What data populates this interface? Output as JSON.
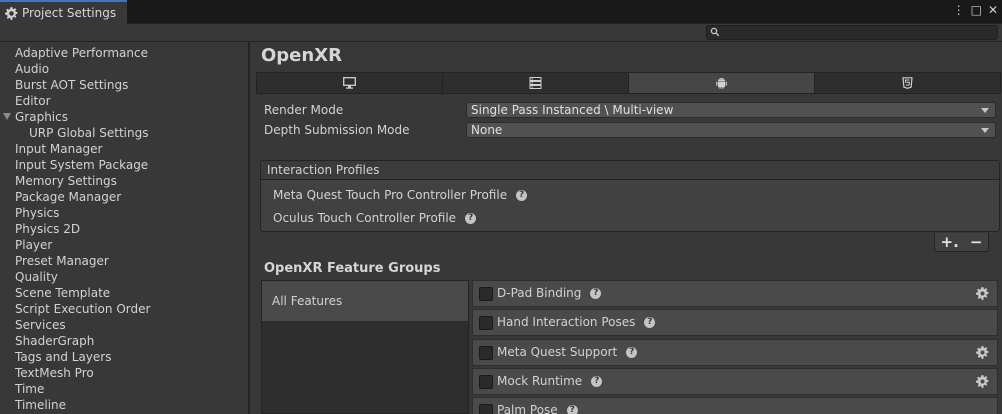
{
  "window": {
    "tab_title": "Project Settings",
    "icons": [
      "gear-icon",
      "kebab-menu-icon",
      "maximize-icon",
      "close-icon"
    ]
  },
  "search": {
    "placeholder": ""
  },
  "sidebar": {
    "items": [
      {
        "label": "Adaptive Performance",
        "level": 0
      },
      {
        "label": "Audio",
        "level": 0
      },
      {
        "label": "Burst AOT Settings",
        "level": 0
      },
      {
        "label": "Editor",
        "level": 0
      },
      {
        "label": "Graphics",
        "level": 0,
        "expanded": true
      },
      {
        "label": "URP Global Settings",
        "level": 1
      },
      {
        "label": "Input Manager",
        "level": 0
      },
      {
        "label": "Input System Package",
        "level": 0
      },
      {
        "label": "Memory Settings",
        "level": 0
      },
      {
        "label": "Package Manager",
        "level": 0
      },
      {
        "label": "Physics",
        "level": 0
      },
      {
        "label": "Physics 2D",
        "level": 0
      },
      {
        "label": "Player",
        "level": 0
      },
      {
        "label": "Preset Manager",
        "level": 0
      },
      {
        "label": "Quality",
        "level": 0
      },
      {
        "label": "Scene Template",
        "level": 0
      },
      {
        "label": "Script Execution Order",
        "level": 0
      },
      {
        "label": "Services",
        "level": 0
      },
      {
        "label": "ShaderGraph",
        "level": 0
      },
      {
        "label": "Tags and Layers",
        "level": 0
      },
      {
        "label": "TextMesh Pro",
        "level": 0
      },
      {
        "label": "Time",
        "level": 0
      },
      {
        "label": "Timeline",
        "level": 0
      }
    ]
  },
  "main": {
    "title": "OpenXR",
    "platform_tabs": [
      {
        "icon": "desktop-icon",
        "active": false
      },
      {
        "icon": "server-icon",
        "active": false
      },
      {
        "icon": "android-icon",
        "active": true
      },
      {
        "icon": "html5-icon",
        "active": false
      }
    ],
    "render_mode": {
      "label": "Render Mode",
      "value": "Single Pass Instanced \\ Multi-view"
    },
    "depth_submission": {
      "label": "Depth Submission Mode",
      "value": "None"
    },
    "interaction_profiles": {
      "header": "Interaction Profiles",
      "items": [
        "Meta Quest Touch Pro Controller Profile",
        "Oculus Touch Controller Profile"
      ]
    },
    "plus_label": "+.",
    "minus_label": "−",
    "feature_groups": {
      "title": "OpenXR Feature Groups",
      "groups": [
        "All Features"
      ],
      "features": [
        {
          "label": "D-Pad Binding",
          "checked": false,
          "settings": true
        },
        {
          "label": "Hand Interaction Poses",
          "checked": false,
          "settings": false
        },
        {
          "label": "Meta Quest Support",
          "checked": false,
          "settings": true
        },
        {
          "label": "Mock Runtime",
          "checked": false,
          "settings": true
        },
        {
          "label": "Palm Pose",
          "checked": false,
          "settings": false
        }
      ]
    }
  },
  "colors": {
    "accent": "#3a79bb",
    "background": "#383838",
    "panel": "#2e2e2e"
  }
}
